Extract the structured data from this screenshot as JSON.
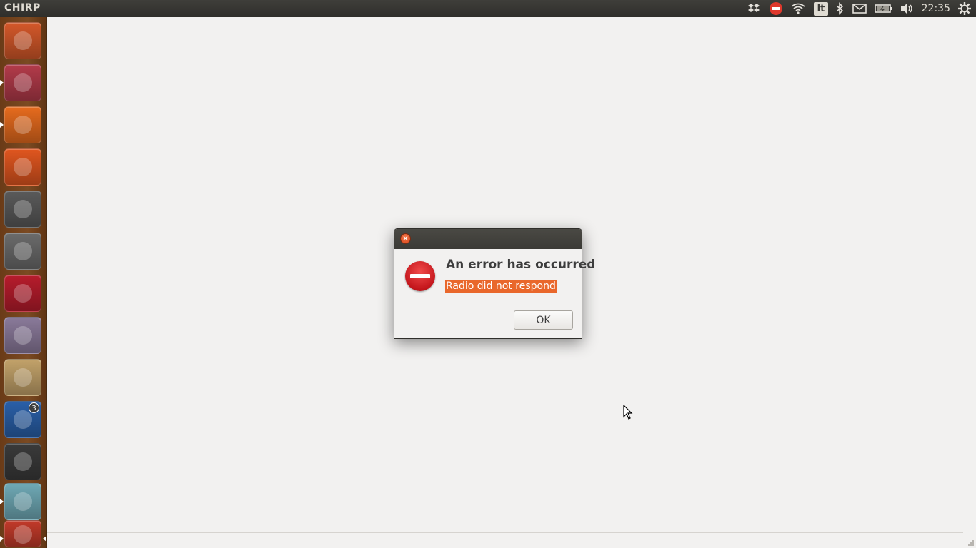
{
  "top_panel": {
    "app_title": "CHIRP",
    "clock": "22:35",
    "keyboard_indicator": "lt",
    "tray_icons": [
      "dropbox-icon",
      "do-not-disturb-icon",
      "wifi-icon",
      "keyboard-layout-icon",
      "bluetooth-icon",
      "mail-icon",
      "battery-icon",
      "volume-icon",
      "settings-icon"
    ]
  },
  "launcher": {
    "items": [
      {
        "name": "dash-home",
        "color": "#d4582a"
      },
      {
        "name": "files",
        "color": "#b33b4a"
      },
      {
        "name": "firefox",
        "color": "#e66b1e"
      },
      {
        "name": "software-center",
        "color": "#e0561f"
      },
      {
        "name": "system-settings",
        "color": "#5a5a5a"
      },
      {
        "name": "startup-disk-creator",
        "color": "#6b6b6b"
      },
      {
        "name": "mendeley",
        "color": "#b71c2c"
      },
      {
        "name": "cheese",
        "color": "#8a7a9a"
      },
      {
        "name": "archive-manager",
        "color": "#c2a26a"
      },
      {
        "name": "thunderbird",
        "color": "#2a5fa8"
      },
      {
        "name": "terminal",
        "color": "#3a3a3a"
      },
      {
        "name": "chirp",
        "color": "#6fa9b5"
      },
      {
        "name": "text-editor",
        "color": "#c23a2a"
      }
    ],
    "thunderbird_badge": "3"
  },
  "dialog": {
    "heading": "An error has occurred",
    "message": "Radio did not respond",
    "ok_label": "OK",
    "close_label": "×"
  },
  "colors": {
    "accent": "#e9672b",
    "panel": "#3c3b37",
    "background": "#f2f1f0"
  }
}
